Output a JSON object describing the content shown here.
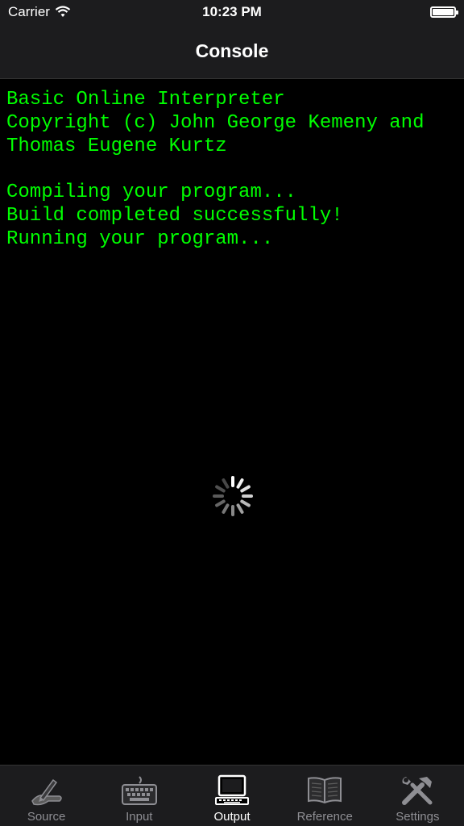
{
  "status_bar": {
    "carrier": "Carrier",
    "time": "10:23 PM"
  },
  "nav": {
    "title": "Console"
  },
  "console": {
    "lines": [
      "Basic Online Interpreter",
      "Copyright (c) John George Kemeny and",
      "Thomas Eugene Kurtz",
      "",
      "Compiling your program...",
      "Build completed successfully!",
      "Running your program..."
    ],
    "text_color": "#00ff00"
  },
  "tabs": [
    {
      "label": "Source",
      "icon": "pen-hand-icon",
      "active": false
    },
    {
      "label": "Input",
      "icon": "keyboard-icon",
      "active": false
    },
    {
      "label": "Output",
      "icon": "monitor-icon",
      "active": true
    },
    {
      "label": "Reference",
      "icon": "book-icon",
      "active": false
    },
    {
      "label": "Settings",
      "icon": "tools-icon",
      "active": false
    }
  ]
}
